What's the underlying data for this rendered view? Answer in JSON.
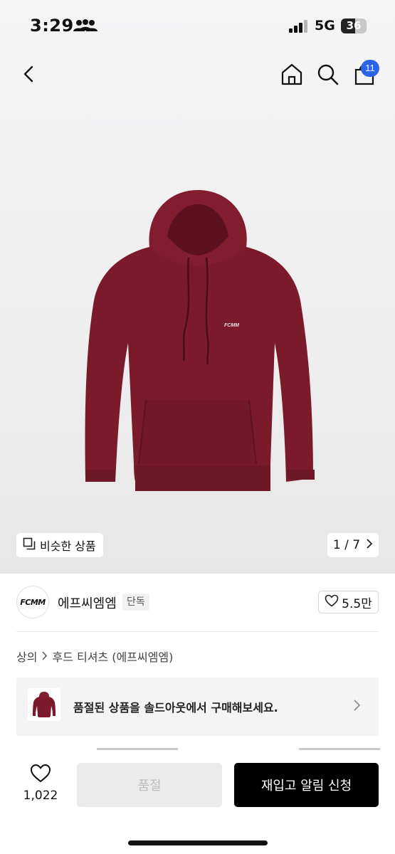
{
  "status_bar": {
    "time": "3:29",
    "network": "5G",
    "battery": "36",
    "icons": [
      "people-icon",
      "signal-icon",
      "battery-icon"
    ]
  },
  "nav": {
    "icons": [
      "back-chevron-icon",
      "home-icon",
      "search-icon",
      "cart-icon"
    ],
    "cart_badge": "11",
    "badge_color": "#2b63e9"
  },
  "gallery": {
    "similar_label": "비슷한 상품",
    "page_indicator": "1 / 7",
    "product_color": "#7a1a2b"
  },
  "brand": {
    "logo_text": "FCMM",
    "name": "에프씨엠엠",
    "tag": "단독",
    "like_count": "5.5만"
  },
  "breadcrumb": {
    "category": "상의",
    "subcategory": "후드 티셔츠 (에프씨엠엠)"
  },
  "soldout_banner": {
    "text": "품절된 상품을 솔드아웃에서 구매해보세요."
  },
  "bottom_bar": {
    "wish_count": "1,022",
    "soldout_label": "품절",
    "restock_label": "재입고 알림 신청"
  }
}
